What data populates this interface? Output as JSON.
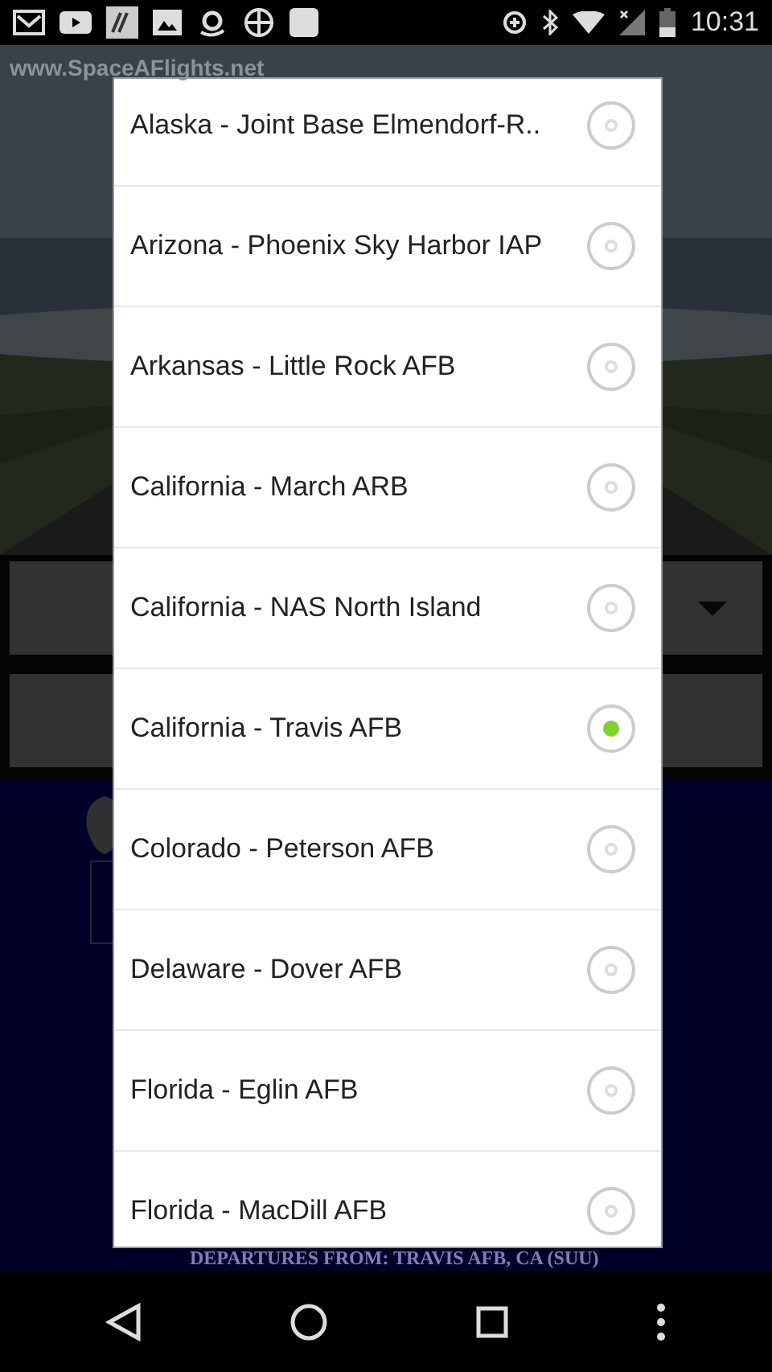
{
  "status_bar": {
    "time": "10:31"
  },
  "background": {
    "site_label": "www.SpaceAFlights.net",
    "footer_text": "DEPARTURES FROM: TRAVIS AFB, CA (SUU)"
  },
  "dialog": {
    "options": [
      {
        "label": "Alaska - Joint Base Elmendorf-R..",
        "selected": false
      },
      {
        "label": "Arizona - Phoenix Sky Harbor IAP",
        "selected": false
      },
      {
        "label": "Arkansas - Little Rock AFB",
        "selected": false
      },
      {
        "label": "California - March ARB",
        "selected": false
      },
      {
        "label": "California - NAS North Island",
        "selected": false
      },
      {
        "label": "California - Travis AFB",
        "selected": true
      },
      {
        "label": "Colorado - Peterson AFB",
        "selected": false
      },
      {
        "label": "Delaware - Dover AFB",
        "selected": false
      },
      {
        "label": "Florida - Eglin AFB",
        "selected": false
      },
      {
        "label": "Florida - MacDill AFB",
        "selected": false
      }
    ]
  }
}
